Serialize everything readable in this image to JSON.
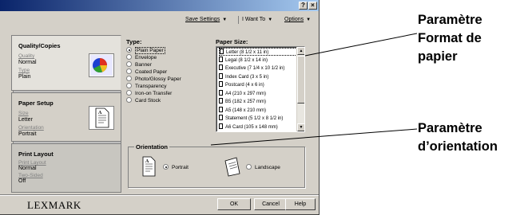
{
  "window": {
    "help_button": "?",
    "close_button": "×"
  },
  "menu": {
    "save_settings": "Save Settings",
    "i_want_to": "I Want To",
    "options": "Options"
  },
  "tabs": {
    "quality": {
      "title": "Quality/Copies",
      "quality_label": "Quality",
      "quality_value": "Normal",
      "type_label": "Type",
      "type_value": "Plain"
    },
    "paper_setup": {
      "title": "Paper Setup",
      "size_label": "Size",
      "size_value": "Letter",
      "orientation_label": "Orientation",
      "orientation_value": "Portrait"
    },
    "print_layout": {
      "title": "Print Layout",
      "layout_label": "Print Layout",
      "layout_value": "Normal",
      "two_sided_label": "Two-Sided",
      "two_sided_value": "Off"
    }
  },
  "type": {
    "label": "Type:",
    "options": [
      "Plain Paper",
      "Envelope",
      "Banner",
      "Coated Paper",
      "Photo/Glossy Paper",
      "Transparency",
      "Iron-on Transfer",
      "Card Stock"
    ],
    "selected_index": 0
  },
  "paper_size": {
    "label": "Paper Size:",
    "items": [
      "Letter (8 1/2 x 11 in)",
      "Legal (8 1/2 x 14 in)",
      "Executive (7 1/4 x 10 1/2 in)",
      "Index Card (3 x 5 in)",
      "Postcard (4 x 6 in)",
      "A4 (210 x 297 mm)",
      "B5 (182 x 257 mm)",
      "A5 (148 x 210 mm)",
      "Statement (5 1/2 x 8 1/2 in)",
      "A6 Card (105 x 148 mm)"
    ],
    "selected_index": 0
  },
  "orientation": {
    "label": "Orientation",
    "portrait": "Portrait",
    "landscape": "Landscape",
    "selected": "portrait"
  },
  "footer": {
    "logo": "LEXMARK",
    "ok": "OK",
    "cancel": "Cancel",
    "help": "Help"
  },
  "callouts": {
    "paper_format": [
      "Paramètre",
      "Format de",
      "papier"
    ],
    "orientation": [
      "Paramètre",
      "d’orientation"
    ]
  }
}
